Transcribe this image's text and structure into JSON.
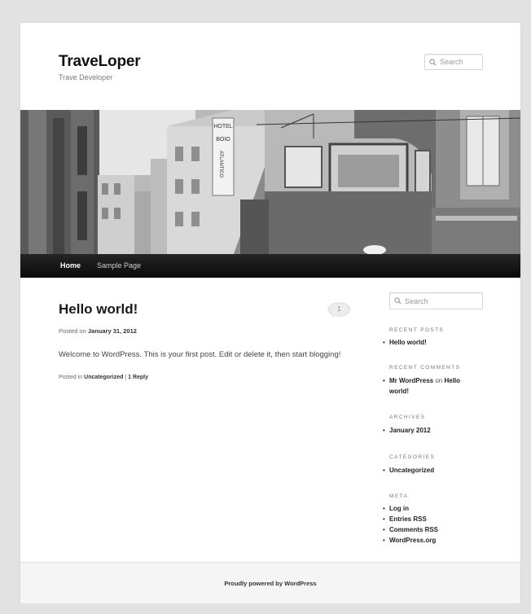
{
  "site": {
    "title": "TraveLoper",
    "description": "Trave Developer"
  },
  "header_search": {
    "placeholder": "Search"
  },
  "hero": {
    "sign_lines": [
      "HOTEL",
      "BOIO",
      "ATLANTICO"
    ]
  },
  "nav": {
    "items": [
      "Home",
      "Sample Page"
    ]
  },
  "post": {
    "title": "Hello world!",
    "comment_count": "1",
    "posted_on_label": "Posted on",
    "date": "January 31, 2012",
    "body": "Welcome to WordPress. This is your first post. Edit or delete it, then start blogging!",
    "posted_in_label": "Posted in",
    "category": "Uncategorized",
    "separator": "|",
    "reply_label": "1 Reply"
  },
  "sidebar": {
    "search_placeholder": "Search",
    "recent_posts": {
      "title": "RECENT POSTS",
      "items": [
        "Hello world!"
      ]
    },
    "recent_comments": {
      "title": "RECENT COMMENTS",
      "author": "Mr WordPress",
      "on_label": "on",
      "post_line1": "Hello",
      "post_line2": "world!"
    },
    "archives": {
      "title": "ARCHIVES",
      "items": [
        "January 2012"
      ]
    },
    "categories": {
      "title": "CATEGORIES",
      "items": [
        "Uncategorized"
      ]
    },
    "meta": {
      "title": "META",
      "items": [
        "Log in",
        "Entries RSS",
        "Comments RSS",
        "WordPress.org"
      ]
    }
  },
  "footer": {
    "text": "Proudly powered by WordPress"
  },
  "colors": {
    "background": "#e2e2e2",
    "page": "#ffffff",
    "navbar": "#111111",
    "text": "#373737"
  }
}
